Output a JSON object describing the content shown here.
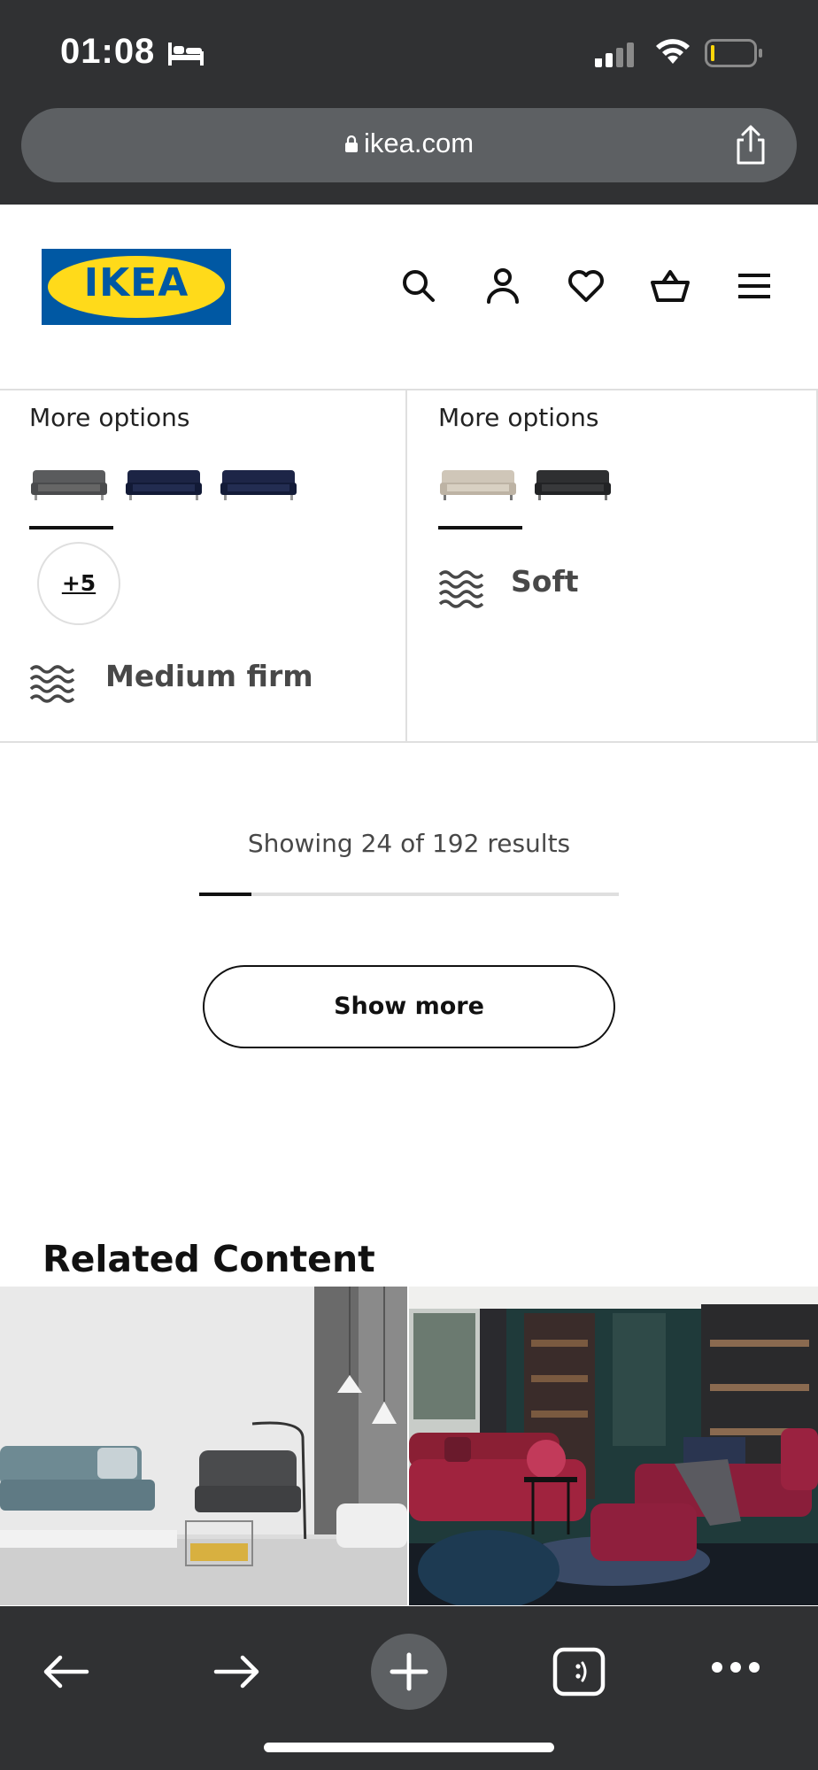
{
  "status_bar": {
    "time": "01:08",
    "icons": [
      "bed-icon",
      "cellular-signal-icon",
      "wifi-icon",
      "battery-icon"
    ]
  },
  "browser": {
    "url": "ikea.com",
    "icons": [
      "lock-icon",
      "share-icon"
    ]
  },
  "header": {
    "logo_text": "IKEA",
    "logo_colors": {
      "blue": "#0058a3",
      "yellow": "#ffda1a"
    },
    "icons": [
      "search-icon",
      "account-icon",
      "favorites-heart-icon",
      "shopping-bag-icon",
      "menu-icon"
    ]
  },
  "products": [
    {
      "more_options_label": "More options",
      "swatches": [
        "dark-grey-sofa",
        "dark-blue-sofa",
        "dark-blue-sofa"
      ],
      "extra_count": "+5",
      "firmness": "Medium firm"
    },
    {
      "more_options_label": "More options",
      "swatches": [
        "beige-sofa",
        "black-sofa"
      ],
      "firmness": "Soft"
    }
  ],
  "results": {
    "text": "Showing 24 of 192 results",
    "progress": 0.125
  },
  "show_more_label": "Show more",
  "related": {
    "title": "Related Content"
  },
  "toolbar": {
    "icons": [
      "back-arrow-icon",
      "forward-arrow-icon",
      "new-tab-plus-icon",
      "tabs-icon",
      "more-icon"
    ]
  }
}
